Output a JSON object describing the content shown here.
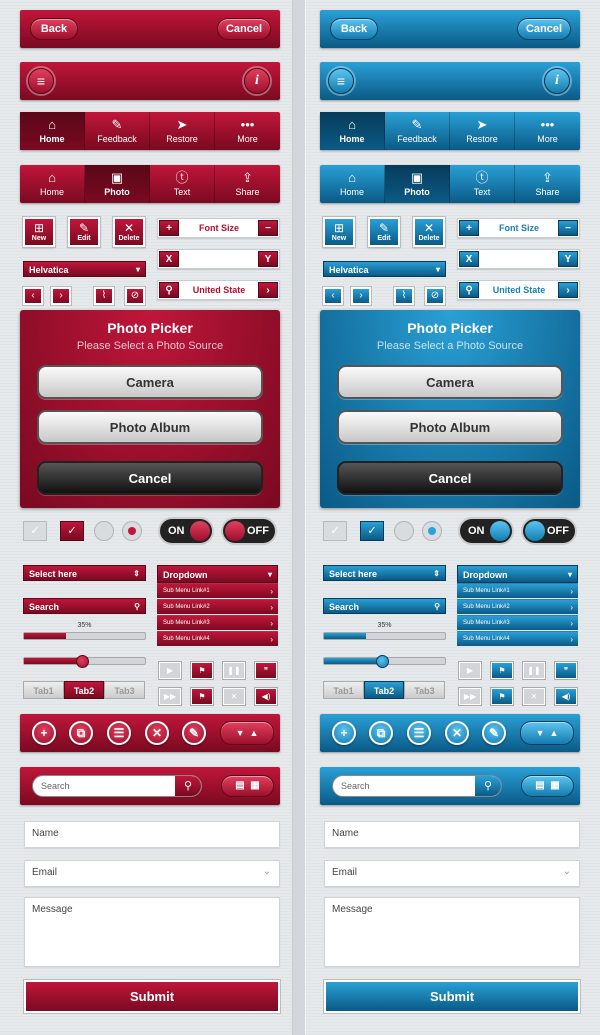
{
  "nav": {
    "back": "Back",
    "cancel": "Cancel"
  },
  "tabbar1": [
    {
      "label": "Home",
      "icon": "home-icon",
      "glyph": "⌂"
    },
    {
      "label": "Feedback",
      "icon": "feedback-icon",
      "glyph": "✎"
    },
    {
      "label": "Restore",
      "icon": "restore-icon",
      "glyph": "➤"
    },
    {
      "label": "More",
      "icon": "more-icon",
      "glyph": "•••"
    }
  ],
  "tabbar2": [
    {
      "label": "Home",
      "icon": "home-icon",
      "glyph": "⌂"
    },
    {
      "label": "Photo",
      "icon": "photo-icon",
      "glyph": "▣"
    },
    {
      "label": "Text",
      "icon": "text-icon",
      "glyph": "ⓣ"
    },
    {
      "label": "Share",
      "icon": "share-icon",
      "glyph": "⇪"
    }
  ],
  "tools": {
    "new": "New",
    "edit": "Edit",
    "delete": "Delete",
    "font_size": "Font Size",
    "plus": "+",
    "minus": "−",
    "x": "X",
    "y": "Y",
    "font": "Helvatica",
    "state": "United State"
  },
  "picker": {
    "title": "Photo Picker",
    "subtitle": "Please Select a Photo Source",
    "camera": "Camera",
    "album": "Photo Album",
    "cancel": "Cancel"
  },
  "toggles": {
    "on": "ON",
    "off": "OFF"
  },
  "controls": {
    "select": "Select here",
    "search": "Search",
    "progress_label": "35%",
    "progress": 35,
    "slider": 0.48,
    "dropdown": "Dropdown",
    "sub_links": [
      "Sub Menu Link#1",
      "Sub Menu Link#2",
      "Sub Menu Link#3",
      "Sub Menu Link#4"
    ],
    "tabs": [
      "Tab1",
      "Tab2",
      "Tab3"
    ],
    "selected_tab": "Tab2"
  },
  "search_bar": {
    "placeholder": "Search"
  },
  "form": {
    "name": "Name",
    "email": "Email",
    "message": "Message",
    "submit": "Submit"
  },
  "colors": {
    "red_accent": "#b3102f",
    "blue_accent": "#1a7fb5"
  }
}
